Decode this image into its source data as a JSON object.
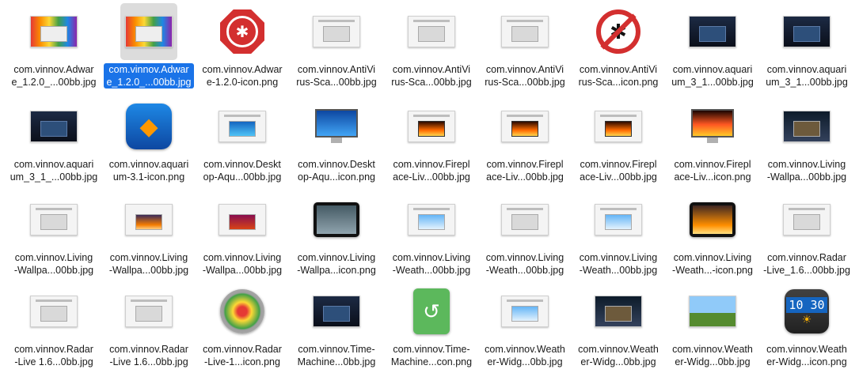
{
  "files": [
    {
      "line1": "com.vinnov.Adwar",
      "line2": "e_1.2.0_...00bb.jpg",
      "icon": "shot-rainbow",
      "selected": false
    },
    {
      "line1": "com.vinnov.Adwar",
      "line2": "e_1.2.0_...00bb.jpg",
      "icon": "shot-rainbow",
      "selected": true
    },
    {
      "line1": "com.vinnov.Adwar",
      "line2": "e-1.2.0-icon.png",
      "icon": "stop-bug",
      "selected": false
    },
    {
      "line1": "com.vinnov.AntiVi",
      "line2": "rus-Sca...00bb.jpg",
      "icon": "shot-plain",
      "selected": false
    },
    {
      "line1": "com.vinnov.AntiVi",
      "line2": "rus-Sca...00bb.jpg",
      "icon": "shot-plain",
      "selected": false
    },
    {
      "line1": "com.vinnov.AntiVi",
      "line2": "rus-Sca...00bb.jpg",
      "icon": "shot-plain",
      "selected": false
    },
    {
      "line1": "com.vinnov.AntiVi",
      "line2": "rus-Sca...icon.png",
      "icon": "no-bug",
      "selected": false
    },
    {
      "line1": "com.vinnov.aquari",
      "line2": "um_3_1...00bb.jpg",
      "icon": "shot-dark",
      "selected": false
    },
    {
      "line1": "com.vinnov.aquari",
      "line2": "um_3_1...00bb.jpg",
      "icon": "shot-dark",
      "selected": false
    },
    {
      "line1": "com.vinnov.aquari",
      "line2": "um_3_1_...00bb.jpg",
      "icon": "shot-dark",
      "selected": false
    },
    {
      "line1": "com.vinnov.aquari",
      "line2": "um-3.1-icon.png",
      "icon": "fish-app",
      "selected": false
    },
    {
      "line1": "com.vinnov.Deskt",
      "line2": "op-Aqu...00bb.jpg",
      "icon": "shot-ocean",
      "selected": false
    },
    {
      "line1": "com.vinnov.Deskt",
      "line2": "op-Aqu...icon.png",
      "icon": "monitor-fish",
      "selected": false
    },
    {
      "line1": "com.vinnov.Firepl",
      "line2": "ace-Liv...00bb.jpg",
      "icon": "shot-fire",
      "selected": false
    },
    {
      "line1": "com.vinnov.Firepl",
      "line2": "ace-Liv...00bb.jpg",
      "icon": "shot-fire",
      "selected": false
    },
    {
      "line1": "com.vinnov.Firepl",
      "line2": "ace-Liv...00bb.jpg",
      "icon": "shot-fire",
      "selected": false
    },
    {
      "line1": "com.vinnov.Firepl",
      "line2": "ace-Liv...icon.png",
      "icon": "monitor-fire",
      "selected": false
    },
    {
      "line1": "com.vinnov.Living",
      "line2": "-Wallpa...00bb.jpg",
      "icon": "shot-night",
      "selected": false
    },
    {
      "line1": "com.vinnov.Living",
      "line2": "-Wallpa...00bb.jpg",
      "icon": "shot-plain",
      "selected": false
    },
    {
      "line1": "com.vinnov.Living",
      "line2": "-Wallpa...00bb.jpg",
      "icon": "shot-sunset",
      "selected": false
    },
    {
      "line1": "com.vinnov.Living",
      "line2": "-Wallpa...00bb.jpg",
      "icon": "shot-red",
      "selected": false
    },
    {
      "line1": "com.vinnov.Living",
      "line2": "-Wallpa...icon.png",
      "icon": "tablet",
      "selected": false
    },
    {
      "line1": "com.vinnov.Living",
      "line2": "-Weath...00bb.jpg",
      "icon": "shot-sky",
      "selected": false
    },
    {
      "line1": "com.vinnov.Living",
      "line2": "-Weath...00bb.jpg",
      "icon": "shot-plain",
      "selected": false
    },
    {
      "line1": "com.vinnov.Living",
      "line2": "-Weath...00bb.jpg",
      "icon": "shot-sky",
      "selected": false
    },
    {
      "line1": "com.vinnov.Living",
      "line2": "-Weath...-icon.png",
      "icon": "tablet-sun",
      "selected": false
    },
    {
      "line1": "com.vinnov.Radar",
      "line2": "-Live_1.6...00bb.jpg",
      "icon": "shot-plain",
      "selected": false
    },
    {
      "line1": "com.vinnov.Radar",
      "line2": "-Live 1.6...0bb.jpg",
      "icon": "shot-plain",
      "selected": false
    },
    {
      "line1": "com.vinnov.Radar",
      "line2": "-Live 1.6...0bb.jpg",
      "icon": "shot-plain",
      "selected": false
    },
    {
      "line1": "com.vinnov.Radar",
      "line2": "-Live-1...icon.png",
      "icon": "radar",
      "selected": false
    },
    {
      "line1": "com.vinnov.Time-",
      "line2": "Machine...0bb.jpg",
      "icon": "shot-dark",
      "selected": false
    },
    {
      "line1": "com.vinnov.Time-",
      "line2": "Machine...con.png",
      "icon": "drive",
      "selected": false
    },
    {
      "line1": "com.vinnov.Weath",
      "line2": "er-Widg...0bb.jpg",
      "icon": "shot-sky",
      "selected": false
    },
    {
      "line1": "com.vinnov.Weath",
      "line2": "er-Widg...0bb.jpg",
      "icon": "shot-night",
      "selected": false
    },
    {
      "line1": "com.vinnov.Weath",
      "line2": "er-Widg...0bb.jpg",
      "icon": "shot-grass",
      "selected": false
    },
    {
      "line1": "com.vinnov.Weath",
      "line2": "er-Widg...icon.png",
      "icon": "clock",
      "selected": false
    }
  ],
  "clock_icon": {
    "digits": "10 30",
    "sun": "☀"
  }
}
